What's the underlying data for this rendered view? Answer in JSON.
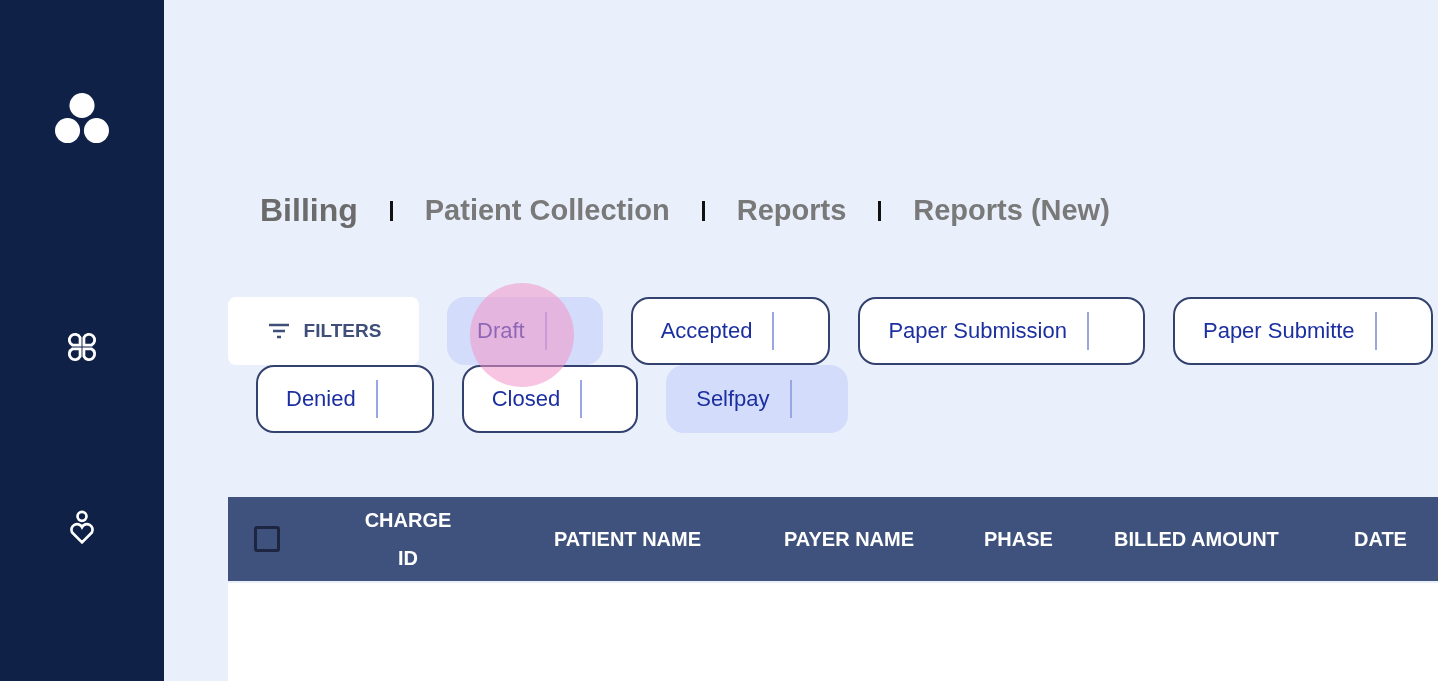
{
  "tabs": [
    {
      "label": "Billing",
      "selected": true
    },
    {
      "label": "Patient Collection",
      "selected": false
    },
    {
      "label": "Reports",
      "selected": false
    },
    {
      "label": "Reports (New)",
      "selected": false
    }
  ],
  "filters_button": {
    "label": "FILTERS"
  },
  "chip_rows": [
    {
      "chips": [
        {
          "label": "Draft",
          "selected": true
        },
        {
          "label": "Accepted",
          "selected": false
        },
        {
          "label": "Paper Submission",
          "selected": false
        },
        {
          "label": "Paper Submitte",
          "selected": false
        }
      ]
    },
    {
      "chips": [
        {
          "label": "Denied",
          "selected": false
        },
        {
          "label": "Closed",
          "selected": false
        },
        {
          "label": "Selfpay",
          "selected": true
        }
      ]
    }
  ],
  "table": {
    "select_all": {
      "checked": false
    },
    "columns": [
      "CHARGE ID",
      "PATIENT NAME",
      "PAYER NAME",
      "PHASE",
      "BILLED AMOUNT",
      "DATE"
    ]
  }
}
